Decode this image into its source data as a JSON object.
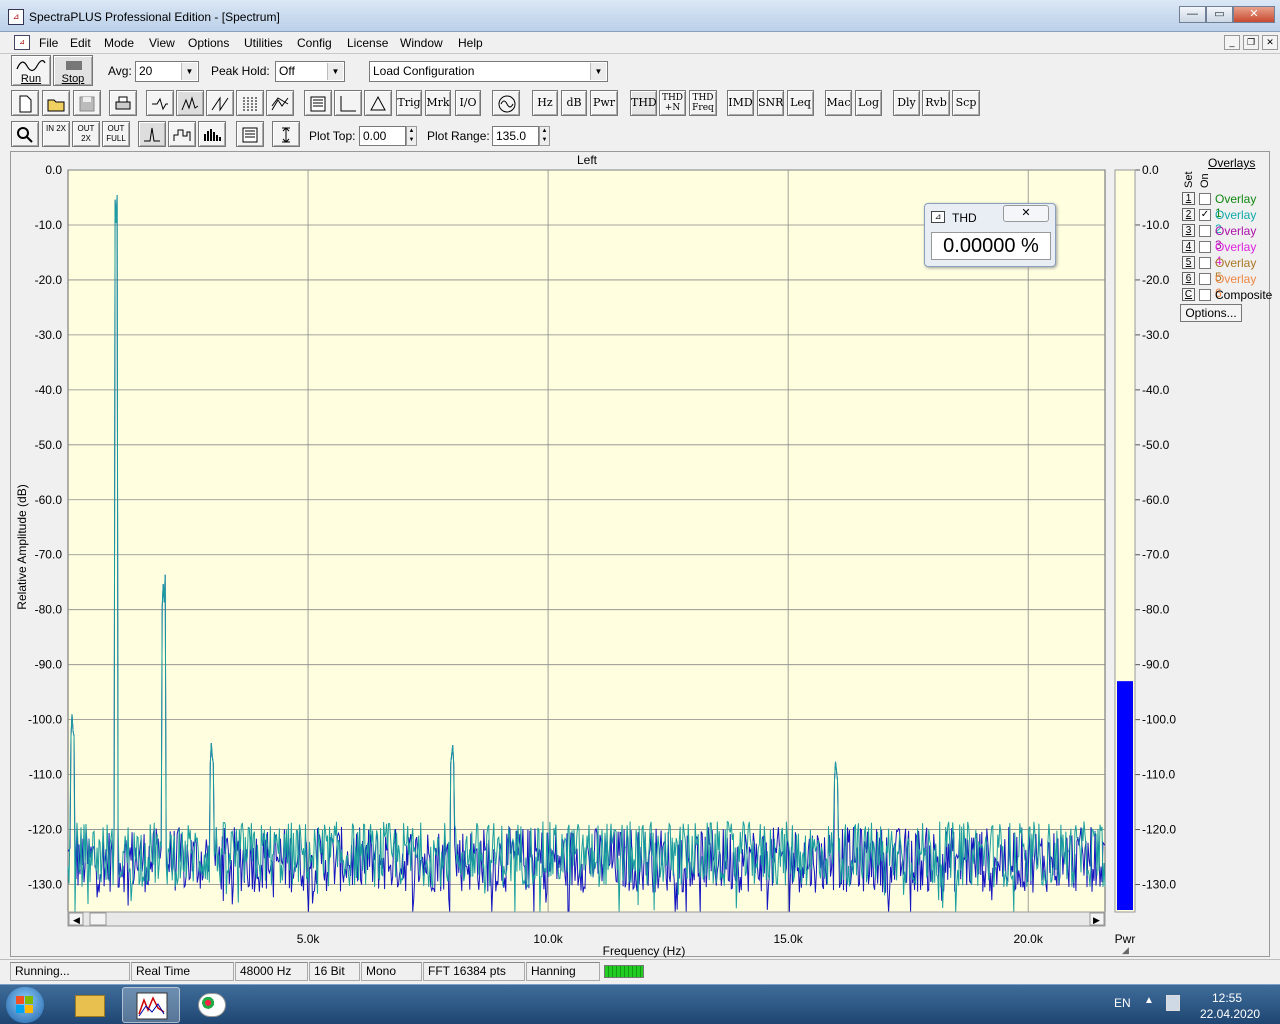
{
  "titlebar": {
    "title": "SpectraPLUS Professional Edition - [Spectrum]",
    "minimize": "—",
    "maximize": "▭",
    "close": "✕"
  },
  "menu": [
    "File",
    "Edit",
    "Mode",
    "View",
    "Options",
    "Utilities",
    "Config",
    "License",
    "Window",
    "Help"
  ],
  "toolbar1": {
    "run_label": "Run",
    "stop_label": "Stop",
    "avg_label": "Avg:",
    "avg_value": "20",
    "peak_label": "Peak Hold:",
    "peak_value": "Off",
    "config_value": "Load Configuration"
  },
  "toolbar2": {
    "text_buttons": [
      "Trig",
      "Mrk",
      "I/O",
      "Hz",
      "dB",
      "Pwr",
      "THD",
      "THD +N",
      "THD Freq",
      "IMD",
      "SNR",
      "Leq",
      "Mac",
      "Log",
      "Dly",
      "Rvb",
      "Scp"
    ]
  },
  "toolbar3": {
    "plot_top_label": "Plot Top:",
    "plot_top_value": "0.00",
    "plot_range_label": "Plot Range:",
    "plot_range_value": "135.0",
    "zoom_in_text": "IN 2X",
    "zoom_out_text": "OUT 2X",
    "zoom_full_text": "OUT FULL"
  },
  "plot": {
    "channel_title": "Left",
    "y_axis_label": "Relative Amplitude (dB)",
    "x_axis_label": "Frequency (Hz)",
    "pwr_label": "Pwr",
    "pwr_level_db": -93,
    "background_color": "#ffffe0",
    "trace1_color": "#1a9e9e",
    "trace2_color": "#1515c0",
    "pwr_bar_color": "#0000ff"
  },
  "thd_window": {
    "title": "THD",
    "value": "0.00000 %"
  },
  "overlays": {
    "title": "Overlays",
    "set_header": "Set",
    "on_header": "On",
    "items": [
      {
        "set": "1",
        "label": "Overlay 1",
        "color": "#118811",
        "checked": false
      },
      {
        "set": "2",
        "label": "Overlay 2",
        "color": "#11aaaa",
        "checked": true
      },
      {
        "set": "3",
        "label": "Overlay 3",
        "color": "#aa11aa",
        "checked": false
      },
      {
        "set": "4",
        "label": "Overlay 4",
        "color": "#dd22dd",
        "checked": false
      },
      {
        "set": "5",
        "label": "Overlay 5",
        "color": "#aa7722",
        "checked": false
      },
      {
        "set": "6",
        "label": "Overlay 6",
        "color": "#ee8844",
        "checked": false
      },
      {
        "set": "C",
        "label": "Composite",
        "color": "#000000",
        "checked": false
      }
    ],
    "options_label": "Options..."
  },
  "statusbar": [
    "Running...",
    "Real Time",
    "48000 Hz",
    "16 Bit",
    "Mono",
    "FFT 16384 pts",
    "Hanning"
  ],
  "taskbar": {
    "lang": "EN",
    "time": "12:55",
    "date": "22.04.2020"
  },
  "chart_data": {
    "type": "line",
    "title": "Left",
    "xlabel": "Frequency (Hz)",
    "ylabel": "Relative Amplitude (dB)",
    "xlim": [
      0,
      21600
    ],
    "ylim": [
      -135,
      0
    ],
    "x_ticks": [
      "5.0k",
      "10.0k",
      "15.0k",
      "20.0k"
    ],
    "y_ticks": [
      "0.0",
      "-10.0",
      "-20.0",
      "-30.0",
      "-40.0",
      "-50.0",
      "-60.0",
      "-70.0",
      "-80.0",
      "-90.0",
      "-100.0",
      "-110.0",
      "-120.0",
      "-130.0"
    ],
    "right_y_ticks": [
      "0.0",
      "-10.0",
      "-20.0",
      "-30.0",
      "-40.0",
      "-50.0",
      "-60.0",
      "-70.0",
      "-80.0",
      "-90.0",
      "-100.0",
      "-110.0",
      "-120.0",
      "-130.0"
    ],
    "noise_floor_db": -125,
    "noise_spread_db": 6,
    "peaks": [
      {
        "freq": 100,
        "db": -103
      },
      {
        "freq": 1000,
        "db": -10
      },
      {
        "freq": 2000,
        "db": -79.5
      },
      {
        "freq": 3000,
        "db": -108
      },
      {
        "freq": 8000,
        "db": -108
      },
      {
        "freq": 16000,
        "db": -111
      }
    ],
    "grid": true
  }
}
